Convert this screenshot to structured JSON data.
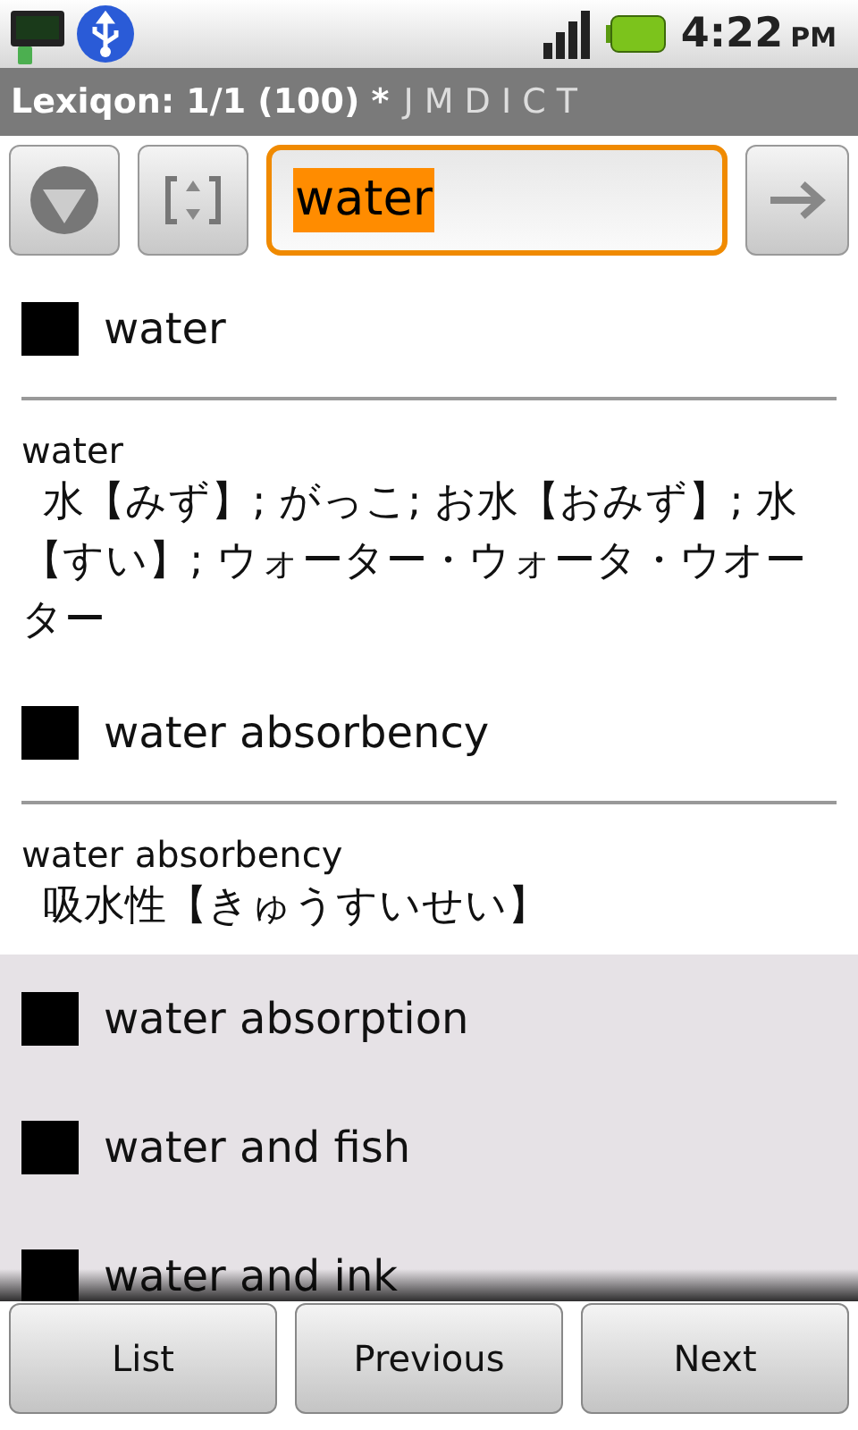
{
  "status_bar": {
    "time": "4:22",
    "ampm": "PM"
  },
  "title_bar": {
    "title": "Lexiqon: 1/1 (100) *",
    "dictionaries": "J M D I C T"
  },
  "search": {
    "value": "water",
    "selected_text": true
  },
  "entries": [
    {
      "term": "water",
      "expanded": true,
      "headword": "water",
      "definition": "水【みず】; がっこ; お水【おみず】; 水【すい】; ウォーター・ウォータ・ウオーター"
    },
    {
      "term": "water absorbency",
      "expanded": true,
      "headword": "water absorbency",
      "definition": "吸水性【きゅうすいせい】"
    },
    {
      "term": "water absorption",
      "expanded": false
    },
    {
      "term": "water and fish",
      "expanded": false
    },
    {
      "term": "water and ink",
      "expanded": false
    }
  ],
  "buttons": [
    "List",
    "Previous",
    "Next"
  ]
}
